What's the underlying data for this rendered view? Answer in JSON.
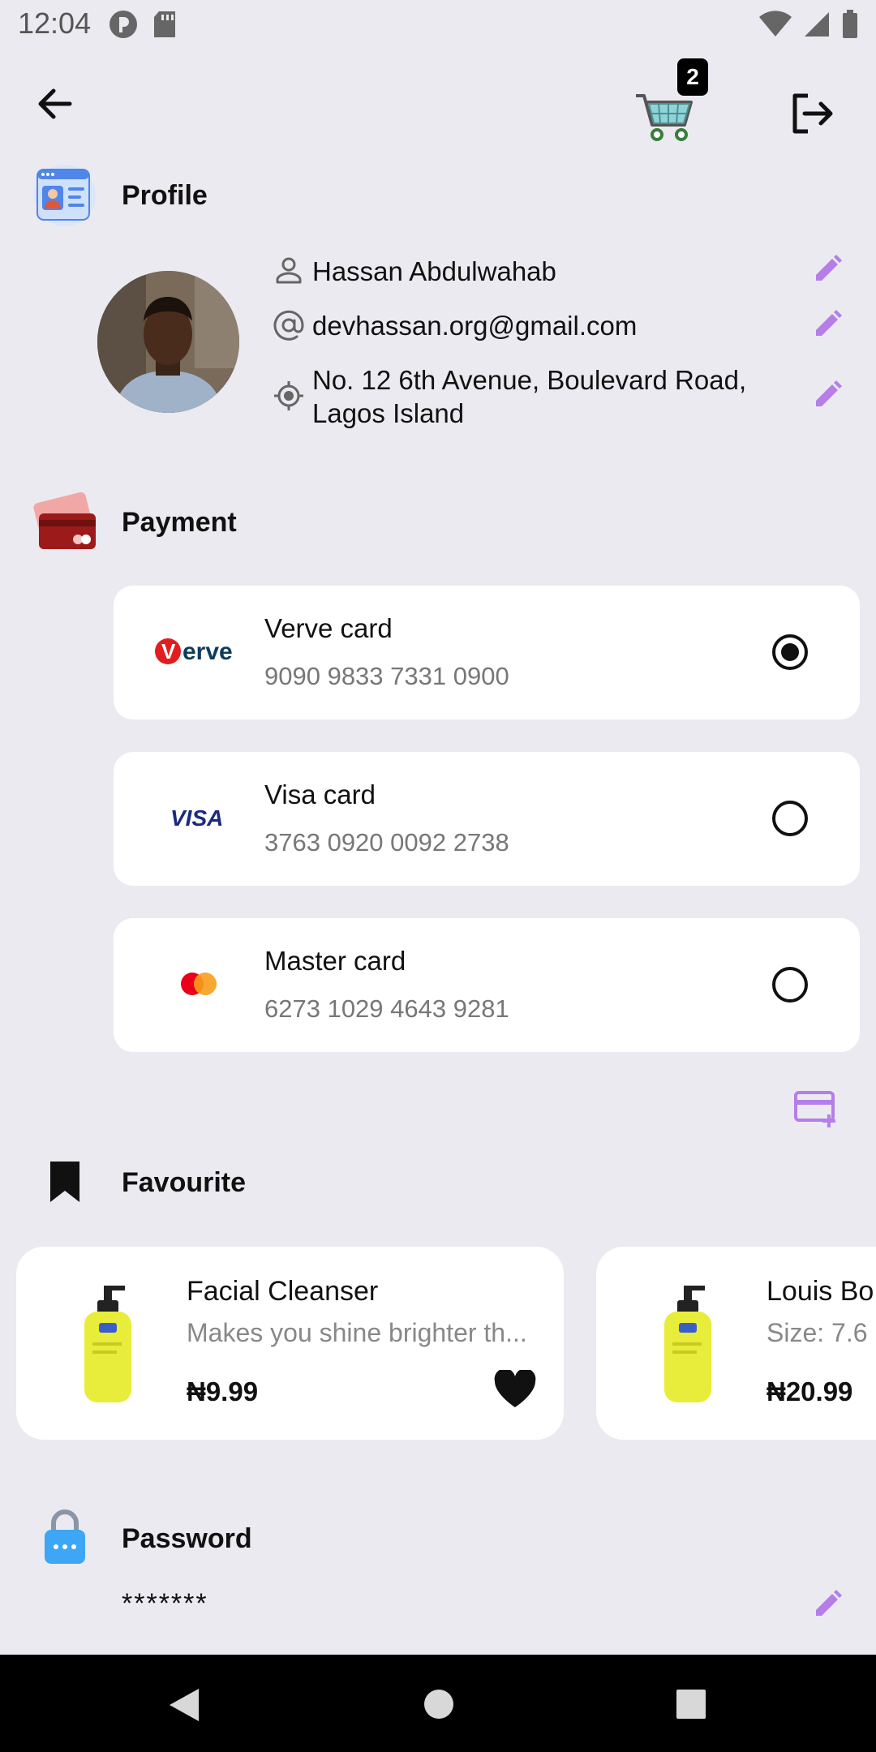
{
  "status_bar": {
    "time": "12:04"
  },
  "header": {
    "cart_count": "2"
  },
  "profile": {
    "title": "Profile",
    "name": "Hassan Abdulwahab",
    "email": "devhassan.org@gmail.com",
    "address": "No. 12 6th Avenue, Boulevard Road, Lagos Island"
  },
  "payment": {
    "title": "Payment",
    "cards": [
      {
        "name": "Verve card",
        "number": "9090 9833 7331 0900",
        "brand": "Verve",
        "selected": true
      },
      {
        "name": "Visa card",
        "number": "3763 0920 0092 2738",
        "brand": "VISA",
        "selected": false
      },
      {
        "name": "Master card",
        "number": "6273 1029 4643 9281",
        "brand": "mastercard",
        "selected": false
      }
    ]
  },
  "favourite": {
    "title": "Favourite",
    "items": [
      {
        "name": "Facial Cleanser",
        "desc": "Makes you shine brighter th...",
        "price": "₦9.99"
      },
      {
        "name": "Louis Bo",
        "desc": "Size: 7.6",
        "price": "₦20.99"
      }
    ]
  },
  "password": {
    "title": "Password",
    "value": "*******"
  },
  "colors": {
    "accent": "#b57ee8",
    "background": "#ebeaf0"
  }
}
